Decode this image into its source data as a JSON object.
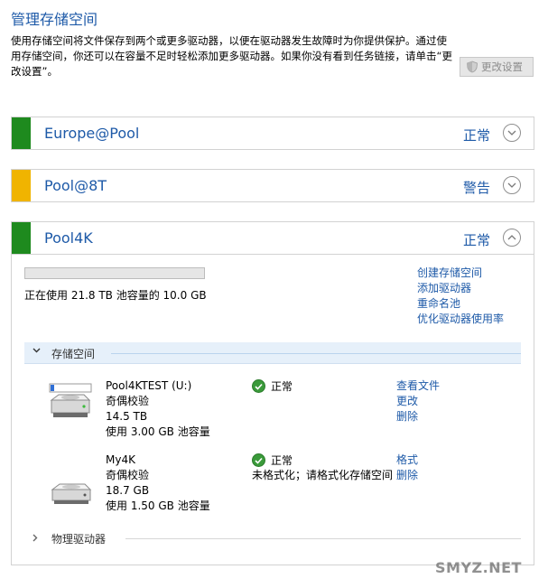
{
  "header": {
    "title": "管理存储空间",
    "description": "使用存储空间将文件保存到两个或更多驱动器，以便在驱动器发生故障时为你提供保护。通过使用存储空间，你还可以在容量不足时轻松添加更多驱动器。如果你没有看到任务链接，请单击“更改设置”。",
    "change_settings": "更改设置"
  },
  "pools": [
    {
      "name": "Europe@Pool",
      "status": "正常",
      "accent": "#1e8a1e"
    },
    {
      "name": "Pool@8T",
      "status": "警告",
      "accent": "#f0b400"
    },
    {
      "name": "Pool4K",
      "status": "正常",
      "accent": "#1e8a1e"
    }
  ],
  "pool_details": {
    "usage_text": "正在使用 21.8 TB 池容量的 10.0 GB",
    "usage_fraction": 0.0,
    "links": [
      "创建存储空间",
      "添加驱动器",
      "重命名池",
      "优化驱动器使用率"
    ],
    "storage_section_label": "存储空间",
    "physical_section_label": "物理驱动器"
  },
  "spaces": [
    {
      "name": "Pool4KTEST (U:)",
      "resiliency": "奇偶校验",
      "size": "14.5 TB",
      "usage": "使用 3.00 GB 池容量",
      "status": "正常",
      "status_note": "",
      "links": [
        "查看文件",
        "更改",
        "删除"
      ]
    },
    {
      "name": "My4K",
      "resiliency": "奇偶校验",
      "size": "18.7 GB",
      "usage": "使用 1.50 GB 池容量",
      "status": "正常",
      "status_note": "未格式化；请格式化存储空间",
      "links": [
        "格式",
        "删除"
      ]
    }
  ],
  "watermark": "SMYZ.NET"
}
